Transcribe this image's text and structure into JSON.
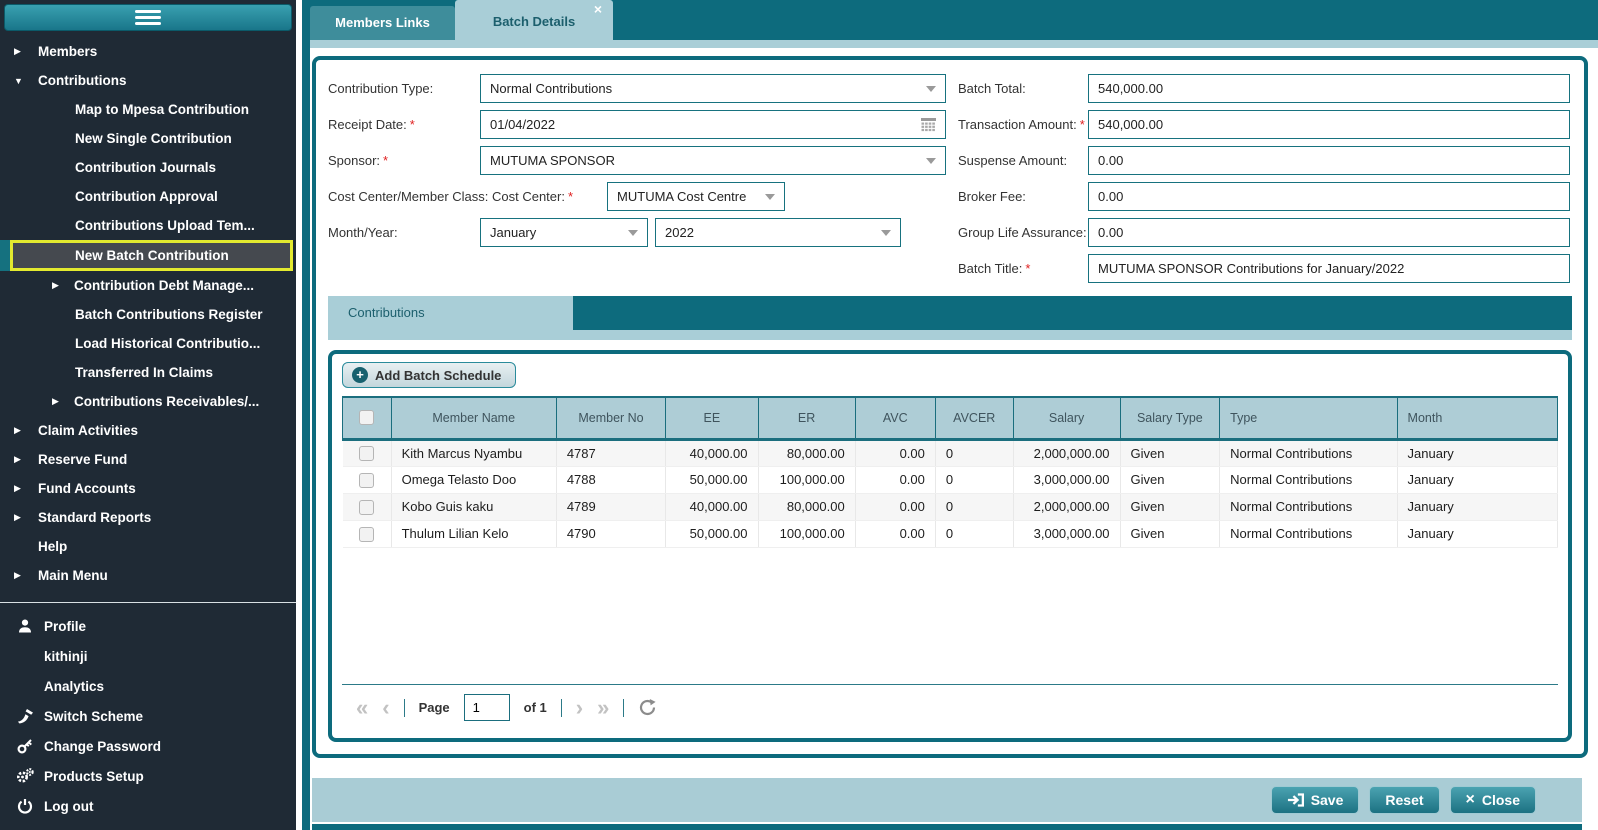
{
  "colors": {
    "teal_dark": "#0d6b7d",
    "teal_mid": "#3e8d9b",
    "blue_light": "#a9ced7",
    "table_header_bg": "#aecdd6",
    "sidebar_bg": "#1f2a35",
    "selected_item_bg": "#45494f",
    "highlight_yellow": "#e3ea2f",
    "required_red": "#e02020",
    "button_gradient_top": "#4ba3b1",
    "button_gradient_bottom": "#1c7182"
  },
  "sidebar": {
    "menu_toggle_icon": "hamburger-icon",
    "items": [
      {
        "label": "Members",
        "arrow": "▶",
        "cls": "root"
      },
      {
        "label": "Contributions",
        "arrow": "▼",
        "cls": "root"
      },
      {
        "label": "Map to Mpesa Contribution",
        "arrow": "",
        "cls": "sub"
      },
      {
        "label": "New Single Contribution",
        "arrow": "",
        "cls": "sub"
      },
      {
        "label": "Contribution Journals",
        "arrow": "",
        "cls": "sub"
      },
      {
        "label": "Contribution Approval",
        "arrow": "",
        "cls": "sub"
      },
      {
        "label": "Contributions Upload Tem...",
        "arrow": "",
        "cls": "sub"
      },
      {
        "label": "New Batch Contribution",
        "arrow": "",
        "cls": "sub sel"
      },
      {
        "label": "Contribution Debt Manage...",
        "arrow": "▶",
        "cls": "subarrow"
      },
      {
        "label": "Batch Contributions Register",
        "arrow": "",
        "cls": "sub"
      },
      {
        "label": "Load Historical Contributio...",
        "arrow": "",
        "cls": "sub"
      },
      {
        "label": "Transferred In Claims",
        "arrow": "",
        "cls": "sub"
      },
      {
        "label": "Contributions Receivables/...",
        "arrow": "▶",
        "cls": "subarrow"
      },
      {
        "label": "Claim Activities",
        "arrow": "▶",
        "cls": "root"
      },
      {
        "label": "Reserve Fund",
        "arrow": "▶",
        "cls": "root"
      },
      {
        "label": "Fund Accounts",
        "arrow": "▶",
        "cls": "root"
      },
      {
        "label": "Standard Reports",
        "arrow": "▶",
        "cls": "root"
      },
      {
        "label": "Help",
        "arrow": "",
        "cls": "root"
      },
      {
        "label": "Main Menu",
        "arrow": "▶",
        "cls": "root"
      }
    ],
    "utility": {
      "profile": "Profile",
      "username": "kithinji",
      "analytics": "Analytics",
      "switch_scheme": "Switch Scheme",
      "change_password": "Change Password",
      "products_setup": "Products Setup",
      "logout": "Log out"
    }
  },
  "tabs": {
    "members_links": "Members Links",
    "batch_details": "Batch Details",
    "close": "×"
  },
  "form": {
    "left": {
      "contribution_type": {
        "label": "Contribution Type:",
        "required": "",
        "value": "Normal Contributions"
      },
      "receipt_date": {
        "label": "Receipt Date:",
        "required": "*",
        "value": "01/04/2022"
      },
      "sponsor": {
        "label": "Sponsor:",
        "required": "*",
        "value": "MUTUMA SPONSOR"
      },
      "cost_center": {
        "label": "Cost Center/Member Class: Cost Center:",
        "required": "*",
        "value": "MUTUMA Cost Centre"
      },
      "month_year": {
        "label": "Month/Year:",
        "month": "January",
        "year": "2022"
      }
    },
    "right": {
      "batch_total": {
        "label": "Batch Total:",
        "required": "",
        "value": "540,000.00"
      },
      "transaction_amount": {
        "label": "Transaction Amount:",
        "required": "*",
        "value": "540,000.00"
      },
      "suspense_amount": {
        "label": "Suspense Amount:",
        "required": "",
        "value": "0.00"
      },
      "broker_fee": {
        "label": "Broker Fee:",
        "required": "",
        "value": "0.00"
      },
      "group_life": {
        "label": "Group Life Assurance:",
        "required": "",
        "value": "0.00"
      },
      "batch_title": {
        "label": "Batch Title:",
        "required": "*",
        "value": "MUTUMA SPONSOR Contributions for January/2022"
      }
    }
  },
  "subtab": {
    "label": "Contributions"
  },
  "table": {
    "add_button": "Add Batch Schedule",
    "add_icon": "plus-circle-icon",
    "columns": [
      "",
      "Member Name",
      "Member No",
      "EE",
      "ER",
      "AVC",
      "AVCER",
      "Salary",
      "Salary Type",
      "Type",
      "Month"
    ],
    "rows": [
      {
        "name": "Kith Marcus Nyambu",
        "member_no": "4787",
        "ee": "40,000.00",
        "er": "80,000.00",
        "avc": "0.00",
        "avcer": "0",
        "salary": "2,000,000.00",
        "salary_type": "Given",
        "type": "Normal Contributions",
        "month": "January"
      },
      {
        "name": "Omega Telasto Doo",
        "member_no": "4788",
        "ee": "50,000.00",
        "er": "100,000.00",
        "avc": "0.00",
        "avcer": "0",
        "salary": "3,000,000.00",
        "salary_type": "Given",
        "type": "Normal Contributions",
        "month": "January"
      },
      {
        "name": "Kobo Guis kaku",
        "member_no": "4789",
        "ee": "40,000.00",
        "er": "80,000.00",
        "avc": "0.00",
        "avcer": "0",
        "salary": "2,000,000.00",
        "salary_type": "Given",
        "type": "Normal Contributions",
        "month": "January"
      },
      {
        "name": "Thulum Lilian Kelo",
        "member_no": "4790",
        "ee": "50,000.00",
        "er": "100,000.00",
        "avc": "0.00",
        "avcer": "0",
        "salary": "3,000,000.00",
        "salary_type": "Given",
        "type": "Normal Contributions",
        "month": "January"
      }
    ]
  },
  "pagination": {
    "first": "«",
    "prev": "‹",
    "page_label": "Page",
    "page_value": "1",
    "of_label": "of 1",
    "next": "›",
    "last": "»"
  },
  "footer": {
    "save": "Save",
    "save_icon": "login-arrow-icon",
    "reset": "Reset",
    "close": "Close",
    "close_icon": "×"
  }
}
